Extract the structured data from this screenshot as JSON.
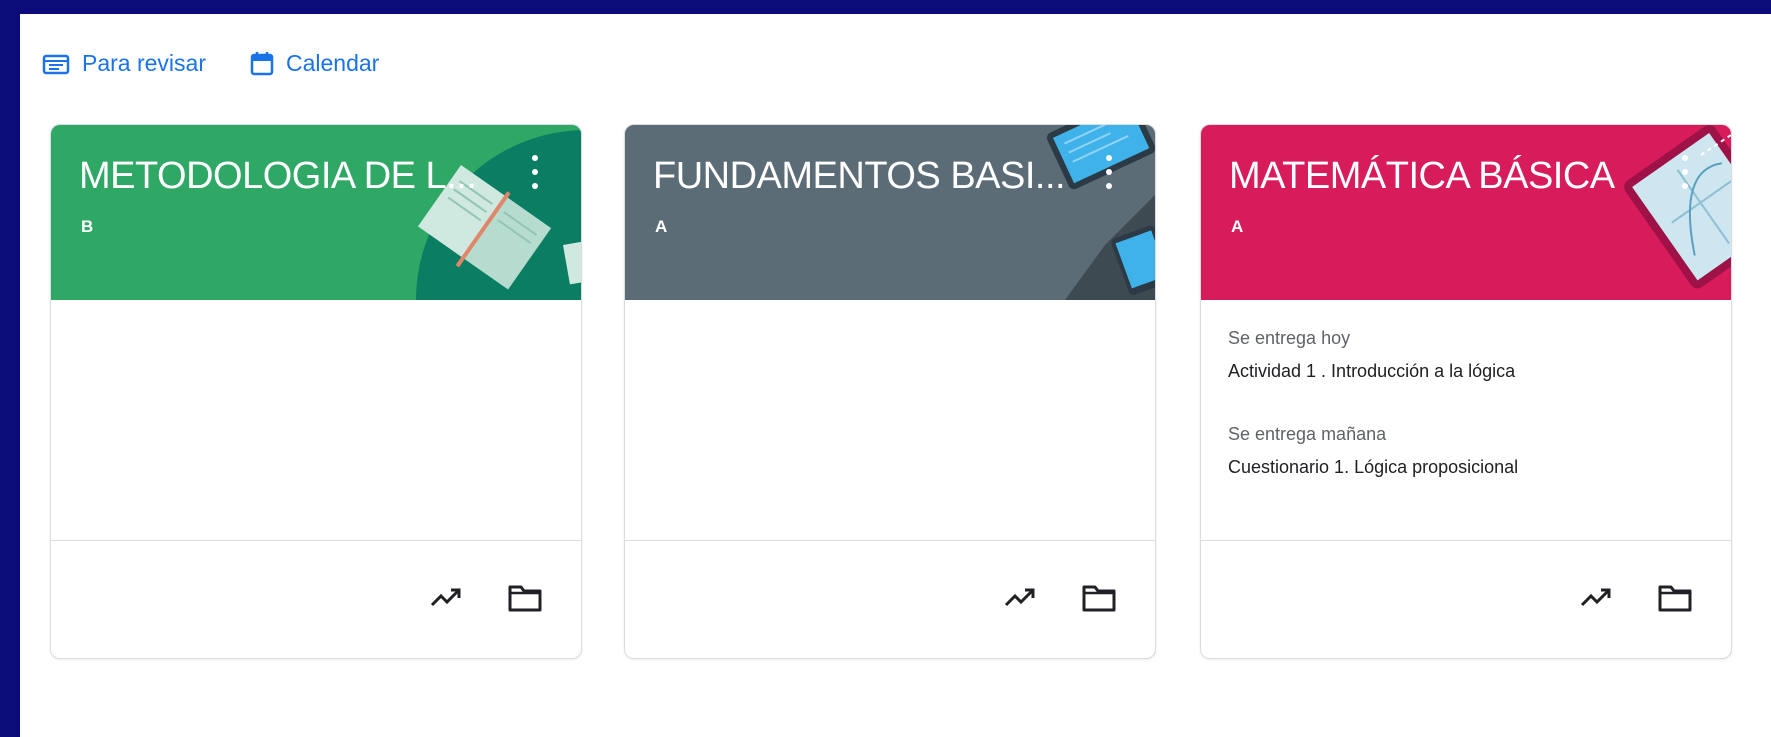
{
  "nav": {
    "to_review_label": "Para revisar",
    "calendar_label": "Calendar"
  },
  "colors": {
    "frame": "#0b0b7a",
    "link": "#1a73e8",
    "card1_banner": "#2fa866",
    "card2_banner": "#5b6c77",
    "card3_banner": "#d81b5a"
  },
  "cards": [
    {
      "title": "METODOLOGIA DE L...",
      "section": "B",
      "due": []
    },
    {
      "title": "FUNDAMENTOS BASI...",
      "section": "A",
      "due": []
    },
    {
      "title": "MATEMÁTICA BÁSICA",
      "section": "A",
      "due": [
        {
          "when": "Se entrega hoy",
          "what": "Actividad 1 . Introducción a la lógica"
        },
        {
          "when": "Se entrega mañana",
          "what": "Cuestionario 1. Lógica proposicional"
        }
      ]
    }
  ],
  "footer_icons": [
    "trending-up-icon",
    "folder-icon"
  ]
}
